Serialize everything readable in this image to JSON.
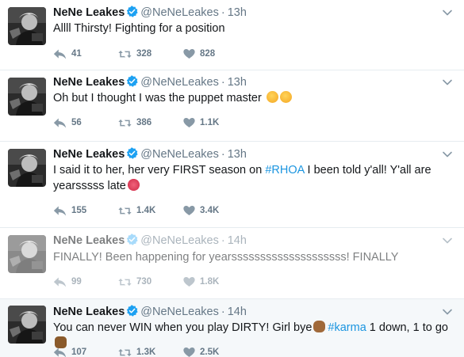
{
  "tweets": [
    {
      "name": "NeNe Leakes",
      "handle": "@NeNeLeakes",
      "dot": "·",
      "time": "13h",
      "text": "Allll Thirsty! Fighting for a position",
      "replies": "41",
      "retweets": "328",
      "likes": "828"
    },
    {
      "name": "NeNe Leakes",
      "handle": "@NeNeLeakes",
      "dot": "·",
      "time": "13h",
      "text": "Oh but I thought I was the puppet master",
      "emoji": [
        "thinking-face-emoji",
        "thinking-face-emoji"
      ],
      "replies": "56",
      "retweets": "386",
      "likes": "1.1K"
    },
    {
      "name": "NeNe Leakes",
      "handle": "@NeNeLeakes",
      "dot": "·",
      "time": "13h",
      "text_before": "I said it to her, her very FIRST season on ",
      "hashtag": "#RHOA",
      "text_after": " I been told y'all! Y'all are yearsssss late",
      "emoji": [
        "lips-emoji"
      ],
      "replies": "155",
      "retweets": "1.4K",
      "likes": "3.4K"
    },
    {
      "name": "NeNe Leakes",
      "handle": "@NeNeLeakes",
      "dot": "·",
      "time": "14h",
      "text": "FINALLY! Been happening for yearssssssssssssssssssss! FINALLY",
      "replies": "99",
      "retweets": "730",
      "likes": "1.8K"
    },
    {
      "name": "NeNe Leakes",
      "handle": "@NeNeLeakes",
      "dot": "·",
      "time": "14h",
      "text_before": "You can never WIN when you play DIRTY! Girl bye",
      "hashtag": "#karma",
      "text_after": " 1 down, 1 to go",
      "emoji": [
        "waving-hand-emoji",
        "fist-bump-emoji"
      ],
      "replies": "107",
      "retweets": "1.3K",
      "likes": "2.5K"
    }
  ],
  "icons": {
    "reply": "reply-icon",
    "retweet": "retweet-icon",
    "like": "heart-icon",
    "verified": "verified-badge-icon",
    "more": "chevron-down-icon"
  },
  "colors": {
    "verified": "#1da1f2",
    "hashtag": "#1b95e0",
    "secondary_text": "#657786",
    "highlight_bg": "#f5f8fa"
  }
}
